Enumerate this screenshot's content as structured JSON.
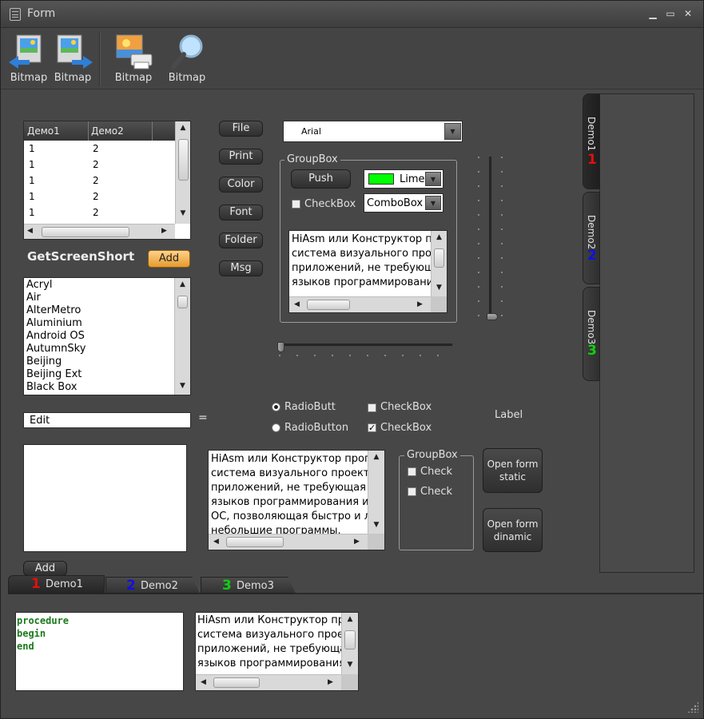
{
  "window": {
    "title": "Form"
  },
  "toolbar": {
    "buttons": [
      {
        "label": "Bitmap"
      },
      {
        "label": "Bitmap"
      },
      {
        "label": "Bitmap"
      },
      {
        "label": "Bitmap"
      }
    ]
  },
  "grid": {
    "columns": [
      "Демо1",
      "Демо2"
    ],
    "rows": [
      [
        "1",
        "2"
      ],
      [
        "1",
        "2"
      ],
      [
        "1",
        "2"
      ],
      [
        "1",
        "2"
      ],
      [
        "1",
        "2"
      ]
    ]
  },
  "side_buttons": [
    "File",
    "Print",
    "Color",
    "Font",
    "Folder",
    "Msg"
  ],
  "screen_label": "GetScreenShort",
  "add_button": "Add",
  "skins": [
    "Acryl",
    "Air",
    "AlterMetro",
    "Aluminium",
    "Android OS",
    "AutumnSky",
    "Beijing",
    "Beijing Ext",
    "Black Box"
  ],
  "font_combo": "Arial",
  "groupbox1": {
    "caption": "GroupBox",
    "push": "Push",
    "color_combo": "Lime",
    "color_swatch": "#00ff00",
    "checkbox": "CheckBox",
    "combo": "ComboBox",
    "memo": [
      "HiAsm или Конструктор про",
      "система визуального проект",
      "приложений, не требующа",
      "языков программировани:"
    ]
  },
  "edit_value": "Edit",
  "equals": "=",
  "radios": [
    "RadioButto",
    "RadioButton"
  ],
  "checks": [
    "CheckBox",
    "CheckBox"
  ],
  "label": "Label",
  "memo2": [
    "HiAsm или Конструктор прогр",
    "система визуального проекти",
    "приложений, не требующая от",
    "языков программирования и с",
    "ОС, позволяющая быстро и ле",
    "небольшие программы."
  ],
  "groupbox2": {
    "caption": "GroupBox",
    "checks": [
      "Check",
      "Check"
    ]
  },
  "open_static": [
    "Open form",
    "static"
  ],
  "open_dinamic": [
    "Open form",
    "dinamic"
  ],
  "add_button2": "Add",
  "vtabs": [
    {
      "num": "1",
      "label": "Demo1",
      "color": "#e01010"
    },
    {
      "num": "2",
      "label": "Demo2",
      "color": "#1010e0"
    },
    {
      "num": "3",
      "label": "Demo3",
      "color": "#10d010"
    }
  ],
  "htabs": [
    {
      "num": "1",
      "label": "Demo1",
      "color": "#e01010"
    },
    {
      "num": "2",
      "label": "Demo2",
      "color": "#1010e0"
    },
    {
      "num": "3",
      "label": "Demo3",
      "color": "#10d010"
    }
  ],
  "code": [
    "procedure",
    "begin",
    "end"
  ],
  "memo3": [
    "HiAsm или Конструктор про",
    "система визуального прое",
    "приложений, не требующа",
    "языков программирования"
  ]
}
